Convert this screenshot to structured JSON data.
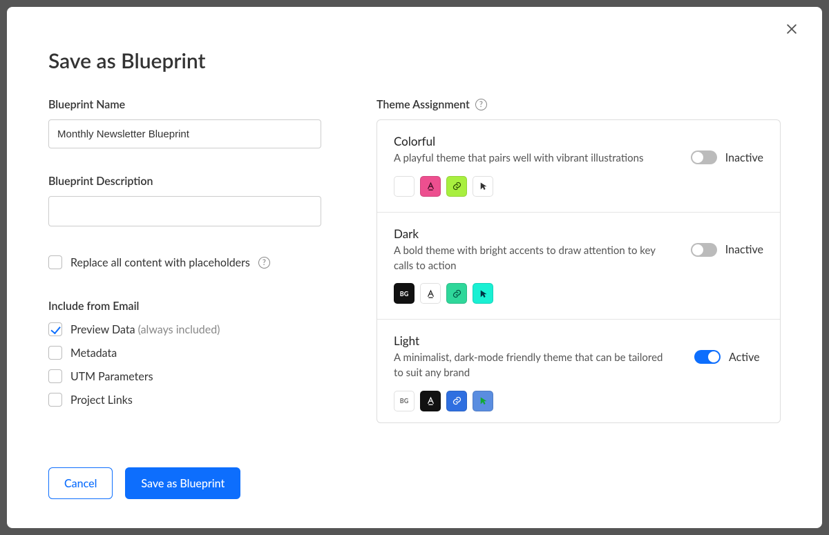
{
  "modal": {
    "title": "Save as Blueprint",
    "name_label": "Blueprint Name",
    "name_value": "Monthly Newsletter Blueprint",
    "desc_label": "Blueprint Description",
    "desc_value": "",
    "replace_label": "Replace all content with placeholders",
    "include_heading": "Include from Email",
    "include_options": {
      "preview": {
        "label": "Preview Data",
        "suffix": "(always included)",
        "checked": true
      },
      "metadata": {
        "label": "Metadata",
        "checked": false
      },
      "utm": {
        "label": "UTM Parameters",
        "checked": false
      },
      "project_links": {
        "label": "Project Links",
        "checked": false
      }
    },
    "cancel_label": "Cancel",
    "save_label": "Save as Blueprint"
  },
  "theme": {
    "heading": "Theme Assignment",
    "status_active": "Active",
    "status_inactive": "Inactive",
    "items": [
      {
        "name": "Colorful",
        "desc": "A playful theme that pairs well with vibrant illustrations",
        "active": false,
        "swatches": [
          {
            "kind": "bg-blank",
            "bg": "#ffffff",
            "fg": "#333"
          },
          {
            "kind": "text",
            "bg": "#ed4f8f",
            "fg": "#3a0a1f"
          },
          {
            "kind": "link",
            "bg": "#a8ef3f",
            "fg": "#2a4a00"
          },
          {
            "kind": "cursor",
            "bg": "#ffffff",
            "fg": "#333"
          }
        ]
      },
      {
        "name": "Dark",
        "desc": "A bold theme with bright accents to draw attention to key calls to action",
        "active": false,
        "swatches": [
          {
            "kind": "bg",
            "bg": "#111111",
            "fg": "#ffffff"
          },
          {
            "kind": "text",
            "bg": "#ffffff",
            "fg": "#222"
          },
          {
            "kind": "link",
            "bg": "#2fd79a",
            "fg": "#054"
          },
          {
            "kind": "cursor",
            "bg": "#19f0d3",
            "fg": "#034"
          }
        ]
      },
      {
        "name": "Light",
        "desc": "A minimalist, dark-mode friendly theme that can be tailored to suit any brand",
        "active": true,
        "swatches": [
          {
            "kind": "bg",
            "bg": "#ffffff",
            "fg": "#666"
          },
          {
            "kind": "text",
            "bg": "#111111",
            "fg": "#ffffff"
          },
          {
            "kind": "link",
            "bg": "#2f6fe0",
            "fg": "#ffffff"
          },
          {
            "kind": "cursor",
            "bg": "#5a8de0",
            "fg": "#1a3"
          }
        ]
      }
    ]
  }
}
